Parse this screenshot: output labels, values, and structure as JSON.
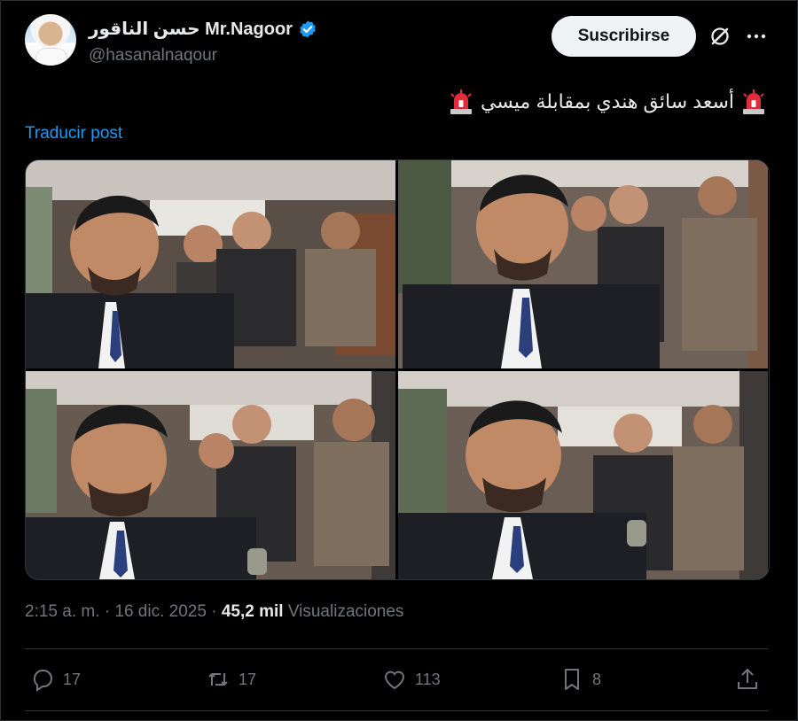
{
  "author": {
    "display_name": "حسن الناقور Mr.Nagoor",
    "handle": "@hasanalnaqour",
    "verified": true
  },
  "header": {
    "subscribe_label": "Suscribirse",
    "grok_icon": "grok-icon",
    "more_icon": "more-dots-icon"
  },
  "tweet": {
    "text": "أسعد سائق هندي بمقابلة ميسي",
    "emoji": "police-siren",
    "translate_label": "Traducir post"
  },
  "meta": {
    "time": "2:15 a. m.",
    "sep1": "·",
    "date": "16 dic. 2025",
    "sep2": "·",
    "views_count": "45,2 mil",
    "views_label": "Visualizaciones"
  },
  "actions": {
    "replies": "17",
    "reposts": "17",
    "likes": "113",
    "bookmarks": "8"
  },
  "colors": {
    "background": "#000000",
    "text": "#e7e9ea",
    "muted": "#71767b",
    "link": "#1d9bf0",
    "verified": "#1d9bf0",
    "border": "#2f3336"
  }
}
